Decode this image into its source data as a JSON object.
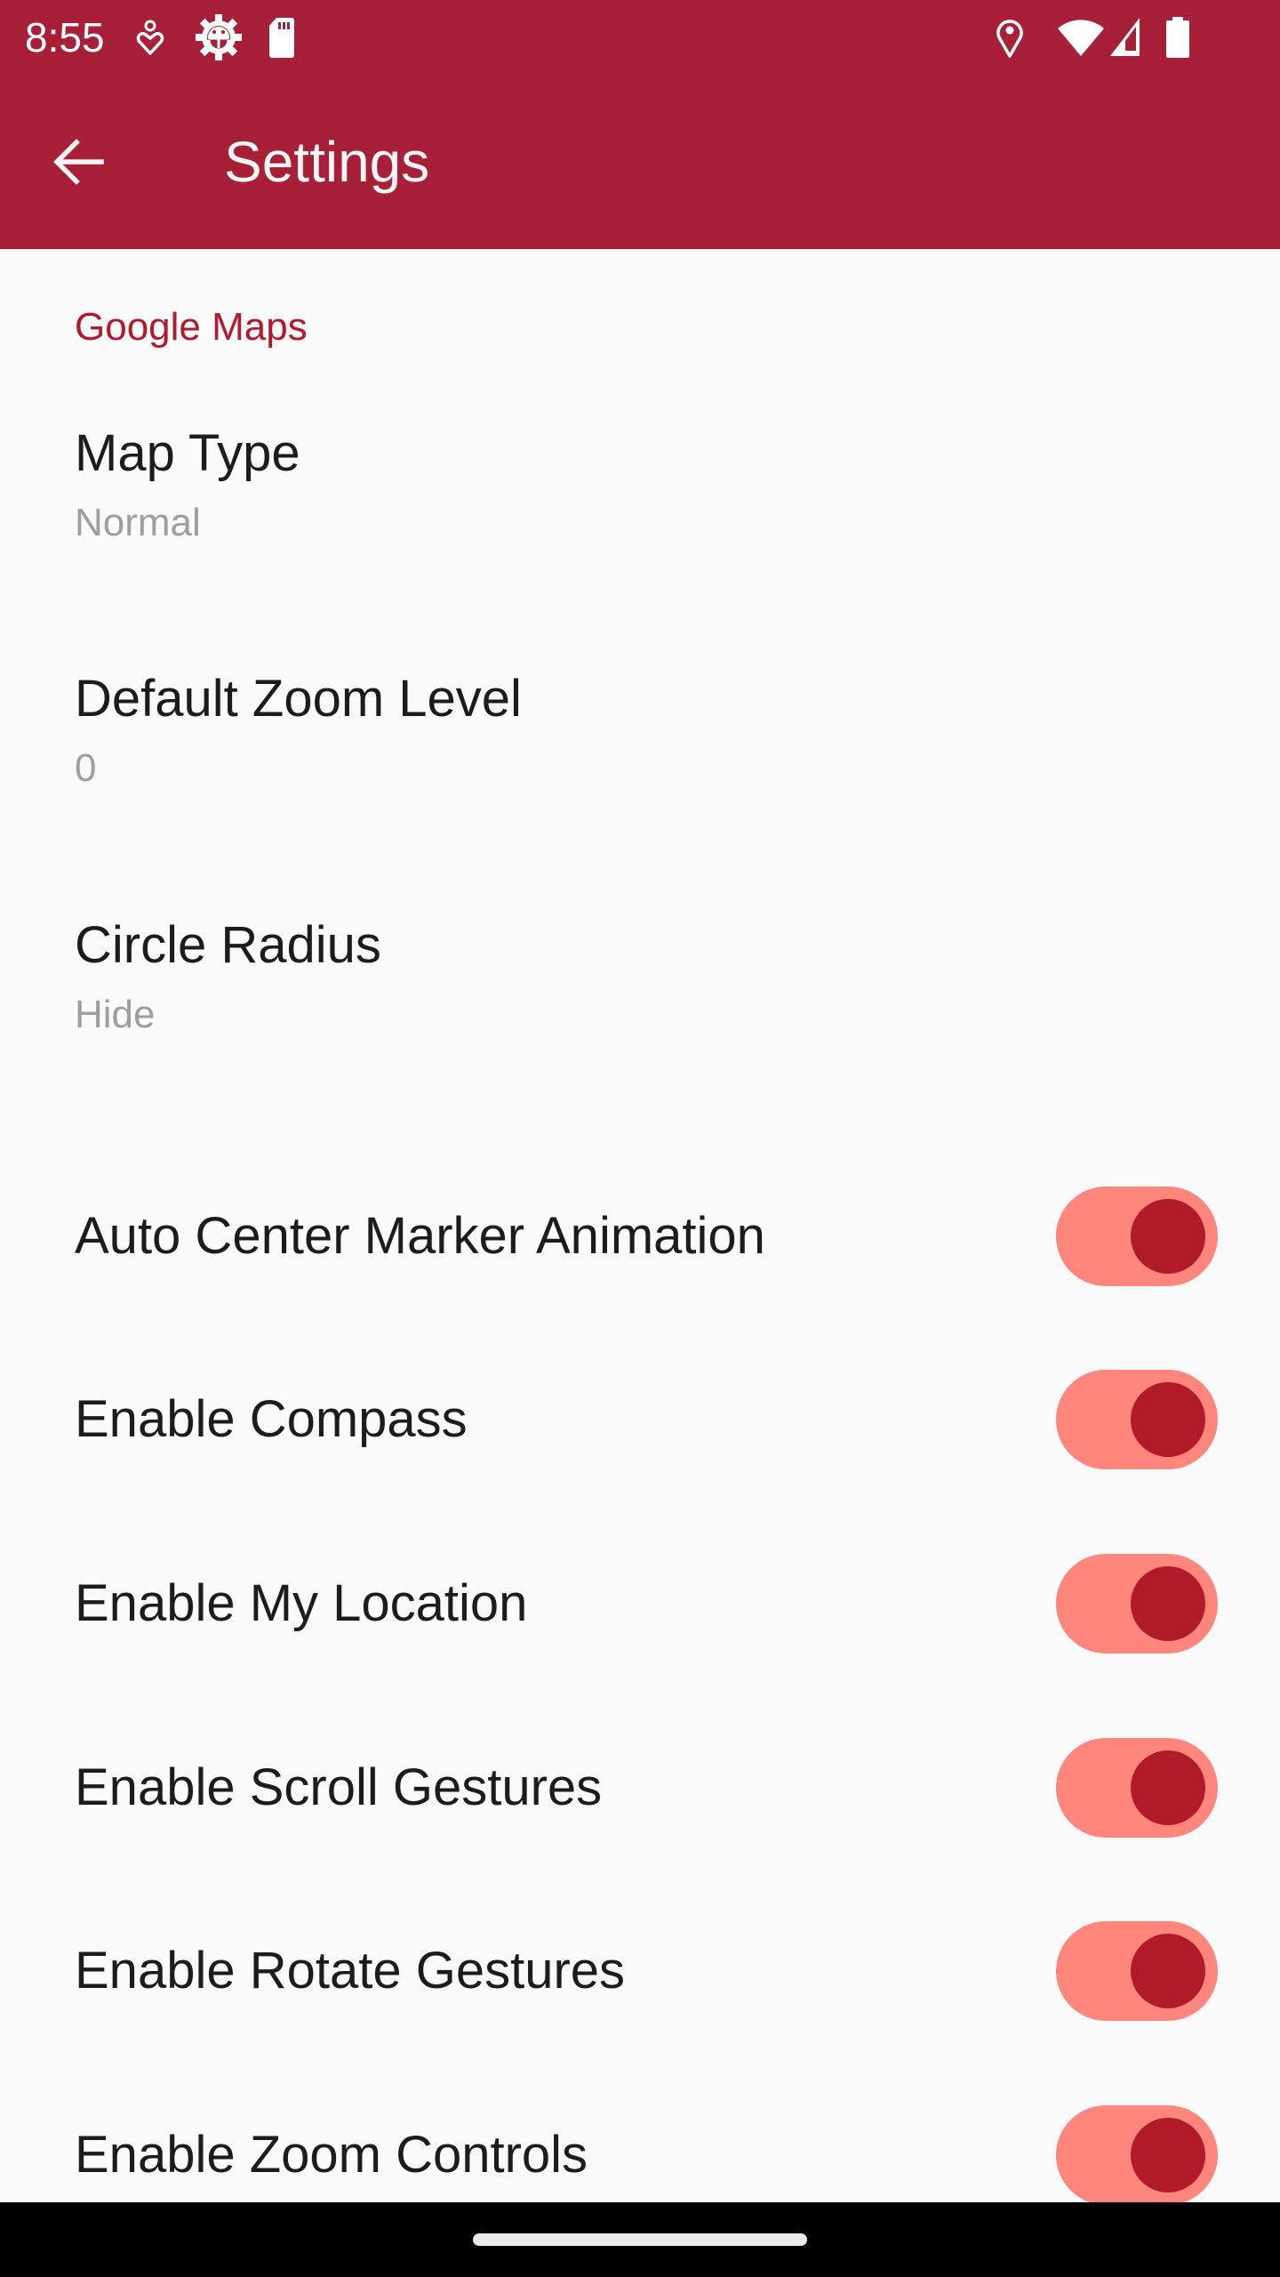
{
  "status_bar": {
    "time": "8:55",
    "left_icons": [
      "accessibility-icon",
      "android-debug-icon",
      "sd-card-icon"
    ],
    "right_icons": [
      "location-icon",
      "wifi-icon",
      "cellular-signal-icon",
      "battery-icon"
    ]
  },
  "app_bar": {
    "back_icon": "arrow-back-icon",
    "title": "Settings"
  },
  "colors": {
    "primary": "#a82038",
    "accent": "#b3192c",
    "switch_track_on": "#ff867c",
    "switch_thumb_on": "#b11a28",
    "background": "#fafafa"
  },
  "section": {
    "title": "Google Maps",
    "list_prefs": [
      {
        "title": "Map Type",
        "summary": "Normal"
      },
      {
        "title": "Default Zoom Level",
        "summary": "0"
      },
      {
        "title": "Circle Radius",
        "summary": "Hide"
      }
    ],
    "switch_prefs": [
      {
        "title": "Auto Center Marker Animation",
        "checked": true
      },
      {
        "title": "Enable Compass",
        "checked": true
      },
      {
        "title": "Enable My Location",
        "checked": true
      },
      {
        "title": "Enable Scroll Gestures",
        "checked": true
      },
      {
        "title": "Enable Rotate Gestures",
        "checked": true
      },
      {
        "title": "Enable Zoom Controls",
        "checked": true
      }
    ]
  }
}
